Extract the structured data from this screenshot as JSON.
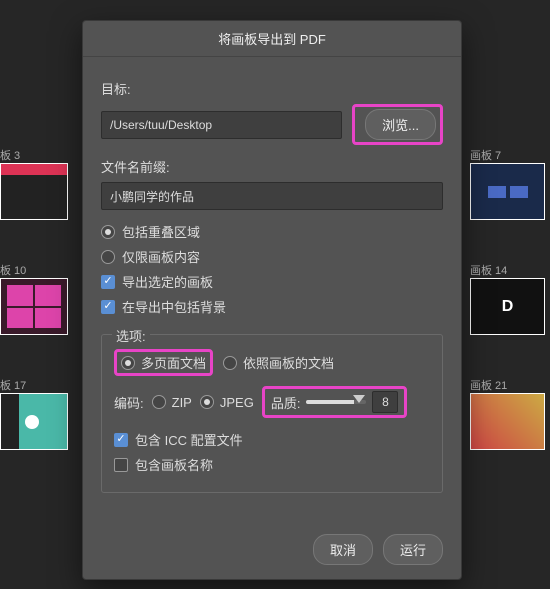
{
  "dialog": {
    "title": "将画板导出到 PDF",
    "dest_label": "目标:",
    "dest_path": "/Users/tuu/Desktop",
    "browse_label": "浏览...",
    "prefix_label": "文件名前缀:",
    "prefix_value": "小鹏同学的作品",
    "opt_overlap": "包括重叠区域",
    "opt_artboard_only": "仅限画板内容",
    "opt_selected": "导出选定的画板",
    "opt_background": "在导出中包括背景"
  },
  "options": {
    "title": "选项:",
    "mode_multipage": "多页面文档",
    "mode_per_artboard": "依照画板的文档",
    "encoding_label": "编码:",
    "encoding_zip": "ZIP",
    "encoding_jpeg": "JPEG",
    "quality_label": "品质:",
    "quality_value": "8",
    "icc": "包含 ICC 配置文件",
    "artboard_name": "包含画板名称"
  },
  "footer": {
    "cancel": "取消",
    "run": "运行"
  },
  "artboards": {
    "a3": "板 3",
    "a7": "画板 7",
    "a10": "板 10",
    "a14": "画板 14",
    "a17": "板 17",
    "a21": "画板 21"
  }
}
